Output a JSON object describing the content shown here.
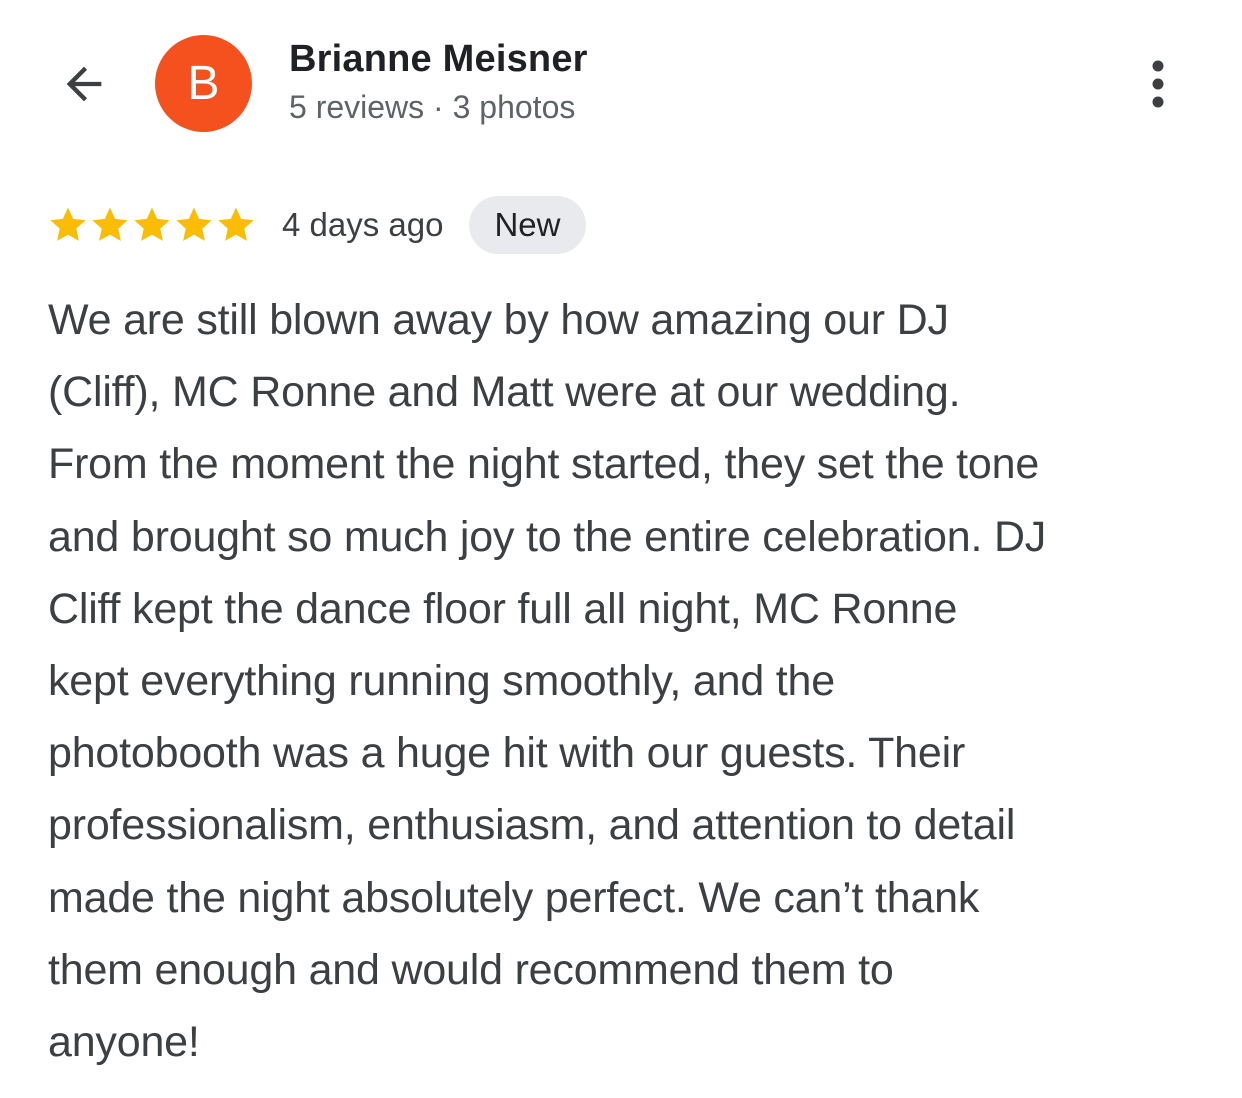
{
  "header": {
    "reviewer_name": "Brianne Meisner",
    "reviewer_meta": "5 reviews · 3 photos",
    "avatar_initial": "B",
    "avatar_color": "#f4511e",
    "back_icon": "arrow-back-icon",
    "more_icon": "more-vert-icon"
  },
  "review": {
    "rating": 5,
    "max_rating": 5,
    "star_color": "#fbbc04",
    "time_ago": "4 days ago",
    "badge": "New",
    "text_lines": [
      "We are still blown away by how amazing our DJ",
      "(Cliff), MC Ronne and Matt were at our wedding.",
      "From the moment the night started, they set the tone",
      "and brought so much joy to the entire celebration. DJ",
      "Cliff kept the dance floor full all night, MC Ronne",
      "kept everything running smoothly, and the",
      "photobooth was a huge hit with our guests. Their",
      "professionalism, enthusiasm, and attention to detail",
      "made the night absolutely perfect. We can’t thank",
      "them enough and would recommend them to",
      "anyone!"
    ]
  }
}
